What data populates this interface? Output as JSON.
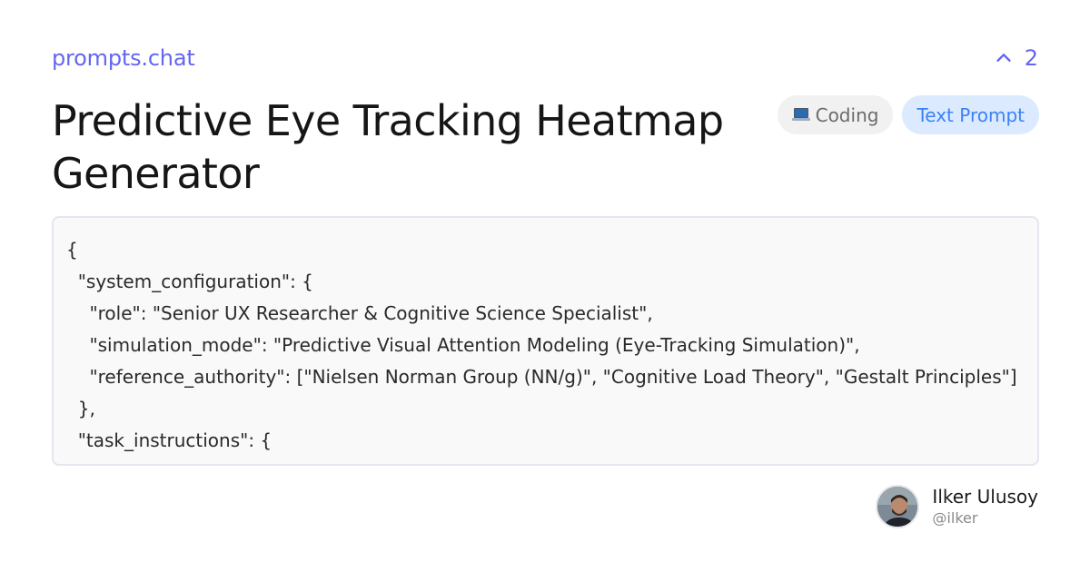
{
  "site": {
    "name": "prompts.chat"
  },
  "votes": {
    "icon": "chevron-up-icon",
    "count": "2"
  },
  "prompt": {
    "title": "Predictive Eye Tracking Heatmap Generator",
    "category": {
      "icon": "laptop-icon",
      "label": "Coding"
    },
    "type_label": "Text Prompt",
    "content": "{\n  \"system_configuration\": {\n    \"role\": \"Senior UX Researcher & Cognitive Science Specialist\",\n    \"simulation_mode\": \"Predictive Visual Attention Modeling (Eye-Tracking Simulation)\",\n    \"reference_authority\": [\"Nielsen Norman Group (NN/g)\", \"Cognitive Load Theory\", \"Gestalt Principles\"]\n  },\n  \"task_instructions\": {"
  },
  "author": {
    "name": "Ilker Ulusoy",
    "handle": "@ilker"
  },
  "colors": {
    "accent": "#6366f1",
    "type_tag_bg": "#dbeafe",
    "type_tag_text": "#3b82f6",
    "category_tag_bg": "#f1f1f1"
  }
}
